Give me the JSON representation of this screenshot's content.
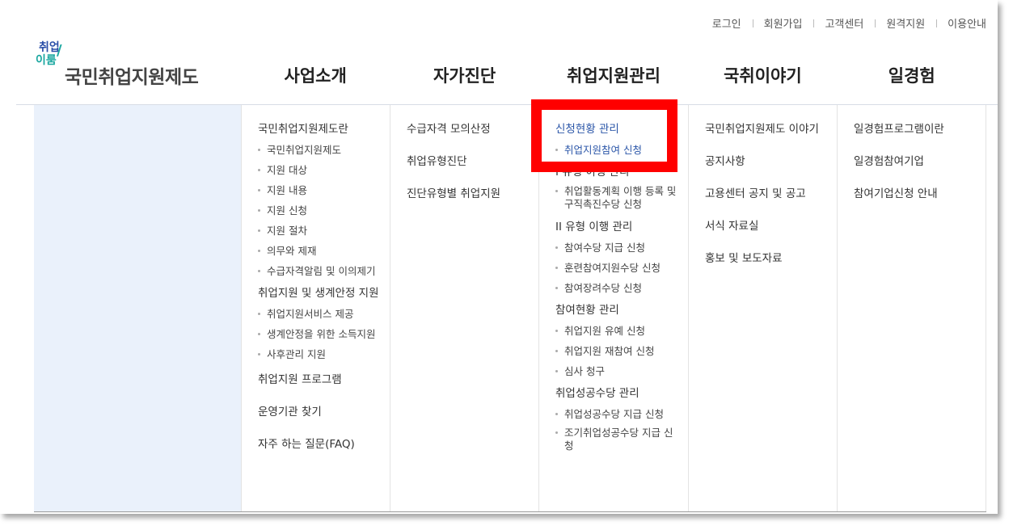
{
  "util_links": [
    "로그인",
    "회원가입",
    "고객센터",
    "원격지원",
    "이용안내"
  ],
  "logo": {
    "mark_top": "취업",
    "mark_bottom": "이룸",
    "text": "국민취업지원제도"
  },
  "gnb": [
    "사업소개",
    "자가진단",
    "취업지원관리",
    "국취이야기",
    "일경험"
  ],
  "menu": {
    "col1": {
      "g1": "국민취업지원제도란",
      "g1_items": [
        "국민취업지원제도",
        "지원 대상",
        "지원 내용",
        "지원 신청",
        "지원 절차",
        "의무와 제재",
        "수급자격알림 및 이의제기"
      ],
      "g2": "취업지원 및 생계안정 지원",
      "g2_items": [
        "취업지원서비스 제공",
        "생계안정을 위한 소득지원",
        "사후관리 지원"
      ],
      "g3": "취업지원 프로그램",
      "g4": "운영기관 찾기",
      "g5": "자주 하는 질문(FAQ)"
    },
    "col2": [
      "수급자격 모의산정",
      "취업유형진단",
      "진단유형별 취업지원"
    ],
    "col3": {
      "g1": "신청현황 관리",
      "g1_items": [
        "취업지원참여 신청"
      ],
      "g2": "I 유형 이행 관리",
      "g2_items": [
        "취업활동계획 이행 등록 및 구직촉진수당 신청"
      ],
      "g3": "II 유형 이행 관리",
      "g3_items": [
        "참여수당 지급 신청",
        "훈련참여지원수당 신청",
        "참여장려수당 신청"
      ],
      "g4": "참여현황 관리",
      "g4_items": [
        "취업지원 유예 신청",
        "취업지원 재참여 신청",
        "심사 청구"
      ],
      "g5": "취업성공수당 관리",
      "g5_items": [
        "취업성공수당 지급 신청",
        "조기취업성공수당 지급 신청"
      ]
    },
    "col4": [
      "국민취업지원제도 이야기",
      "공지사항",
      "고용센터 공지 및 공고",
      "서식 자료실",
      "홍보 및 보도자료"
    ],
    "col5": [
      "일경험프로그램이란",
      "일경험참여기업",
      "참여기업신청 안내"
    ]
  },
  "colors": {
    "highlight": "#ff0000",
    "active": "#2b56a8",
    "side_bg": "#eaf1fb"
  }
}
